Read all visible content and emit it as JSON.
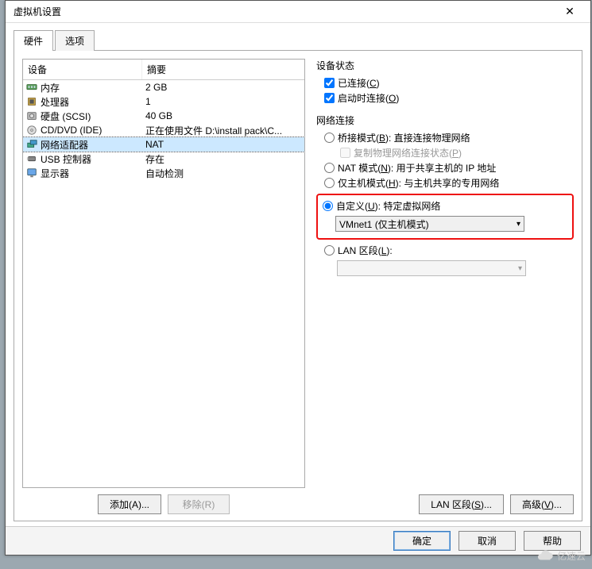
{
  "window": {
    "title": "虚拟机设置"
  },
  "tabs": {
    "hardware": "硬件",
    "options": "选项"
  },
  "columns": {
    "device": "设备",
    "summary": "摘要"
  },
  "devices": [
    {
      "name": "内存",
      "summary": "2 GB",
      "icon": "memory"
    },
    {
      "name": "处理器",
      "summary": "1",
      "icon": "cpu"
    },
    {
      "name": "硬盘 (SCSI)",
      "summary": "40 GB",
      "icon": "disk"
    },
    {
      "name": "CD/DVD (IDE)",
      "summary": "正在使用文件 D:\\install pack\\C...",
      "icon": "cd"
    },
    {
      "name": "网络适配器",
      "summary": "NAT",
      "icon": "net",
      "selected": true
    },
    {
      "name": "USB 控制器",
      "summary": "存在",
      "icon": "usb"
    },
    {
      "name": "显示器",
      "summary": "自动检测",
      "icon": "display"
    }
  ],
  "buttons": {
    "add": "添加(A)...",
    "remove": "移除(R)"
  },
  "status": {
    "title": "设备状态",
    "connected": {
      "label": "已连接(C)",
      "prefix": "已连接(",
      "hot": "C",
      "suffix": ")",
      "checked": true
    },
    "connectAtPowerOn": {
      "label": "启动时连接(O)",
      "prefix": "启动时连接(",
      "hot": "O",
      "suffix": ")",
      "checked": true
    }
  },
  "net": {
    "title": "网络连接",
    "bridged": {
      "prefix": "桥接模式(",
      "hot": "B",
      "suffix": "): 直接连接物理网络"
    },
    "replicate": {
      "prefix": "复制物理网络连接状态(",
      "hot": "P",
      "suffix": ")"
    },
    "nat": {
      "prefix": "NAT 模式(",
      "hot": "N",
      "suffix": "): 用于共享主机的 IP 地址"
    },
    "host": {
      "prefix": "仅主机模式(",
      "hot": "H",
      "suffix": "): 与主机共享的专用网络"
    },
    "custom": {
      "prefix": "自定义(",
      "hot": "U",
      "suffix": "): 特定虚拟网络"
    },
    "customValue": "VMnet1 (仅主机模式)",
    "lanseg": {
      "prefix": "LAN 区段(",
      "hot": "L",
      "suffix": "):"
    },
    "lansegBtn": {
      "prefix": "LAN 区段(",
      "hot": "S",
      "suffix": ")..."
    },
    "advancedBtn": {
      "prefix": "高级(",
      "hot": "V",
      "suffix": ")..."
    }
  },
  "footer": {
    "ok": "确定",
    "cancel": "取消",
    "help": "帮助"
  },
  "watermark": "亿速云"
}
